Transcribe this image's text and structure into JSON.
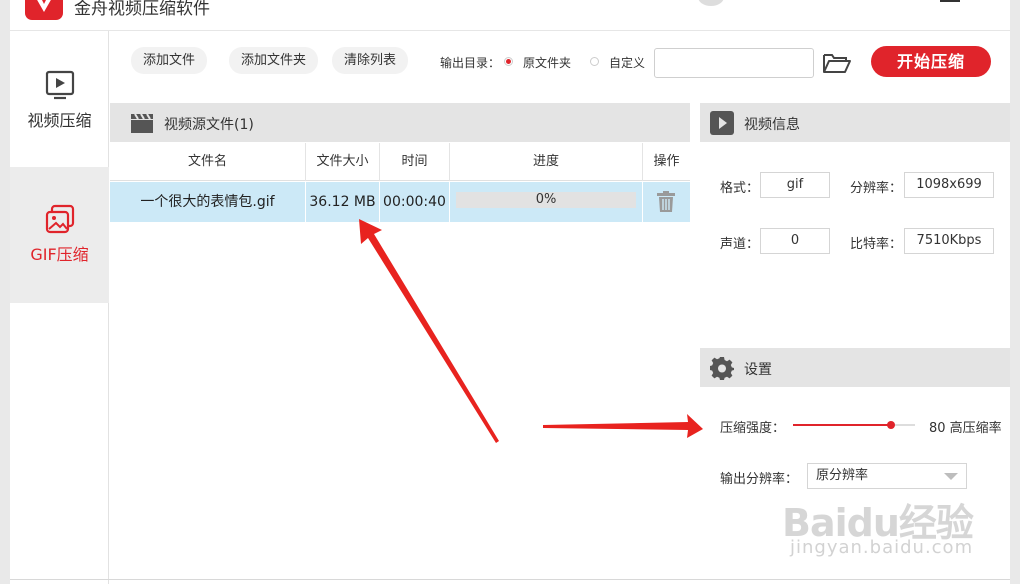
{
  "window": {
    "title": "金舟视频压缩软件"
  },
  "sidebar": {
    "items": [
      {
        "label": "视频压缩",
        "icon": "video-play-icon",
        "active": false
      },
      {
        "label": "GIF压缩",
        "icon": "gif-image-icon",
        "active": true
      }
    ]
  },
  "toolbar": {
    "add_file": "添加文件",
    "add_folder": "添加文件夹",
    "clear_list": "清除列表",
    "output_label": "输出目录：",
    "option_original": "原文件夹",
    "option_custom": "自定义",
    "path_value": "",
    "path_placeholder": "",
    "start": "开始压缩"
  },
  "files": {
    "header": "视频源文件(1)",
    "columns": [
      "文件名",
      "文件大小",
      "时间",
      "进度",
      "操作"
    ],
    "rows": [
      {
        "name": "一个很大的表情包.gif",
        "size": "36.12 MB",
        "time": "00:00:40",
        "progress": "0%",
        "progress_value": 0
      }
    ]
  },
  "info": {
    "title": "视频信息",
    "format_label": "格式：",
    "format_value": "gif",
    "resolution_label": "分辨率：",
    "resolution_value": "1098x699",
    "channel_label": "声道：",
    "channel_value": "0",
    "bitrate_label": "比特率：",
    "bitrate_value": "7510Kbps"
  },
  "settings": {
    "title": "设置",
    "strength_label": "压缩强度：",
    "strength_value": 80,
    "strength_text": "80 高压缩率",
    "resolution_label": "输出分辨率：",
    "resolution_value": "原分辨率"
  },
  "watermark": {
    "logo": "Baidu经验",
    "url": "jingyan.baidu.com"
  },
  "colors": {
    "accent": "#e0242b",
    "selected_row": "#cce9f7",
    "annotation": "#e8231f"
  }
}
